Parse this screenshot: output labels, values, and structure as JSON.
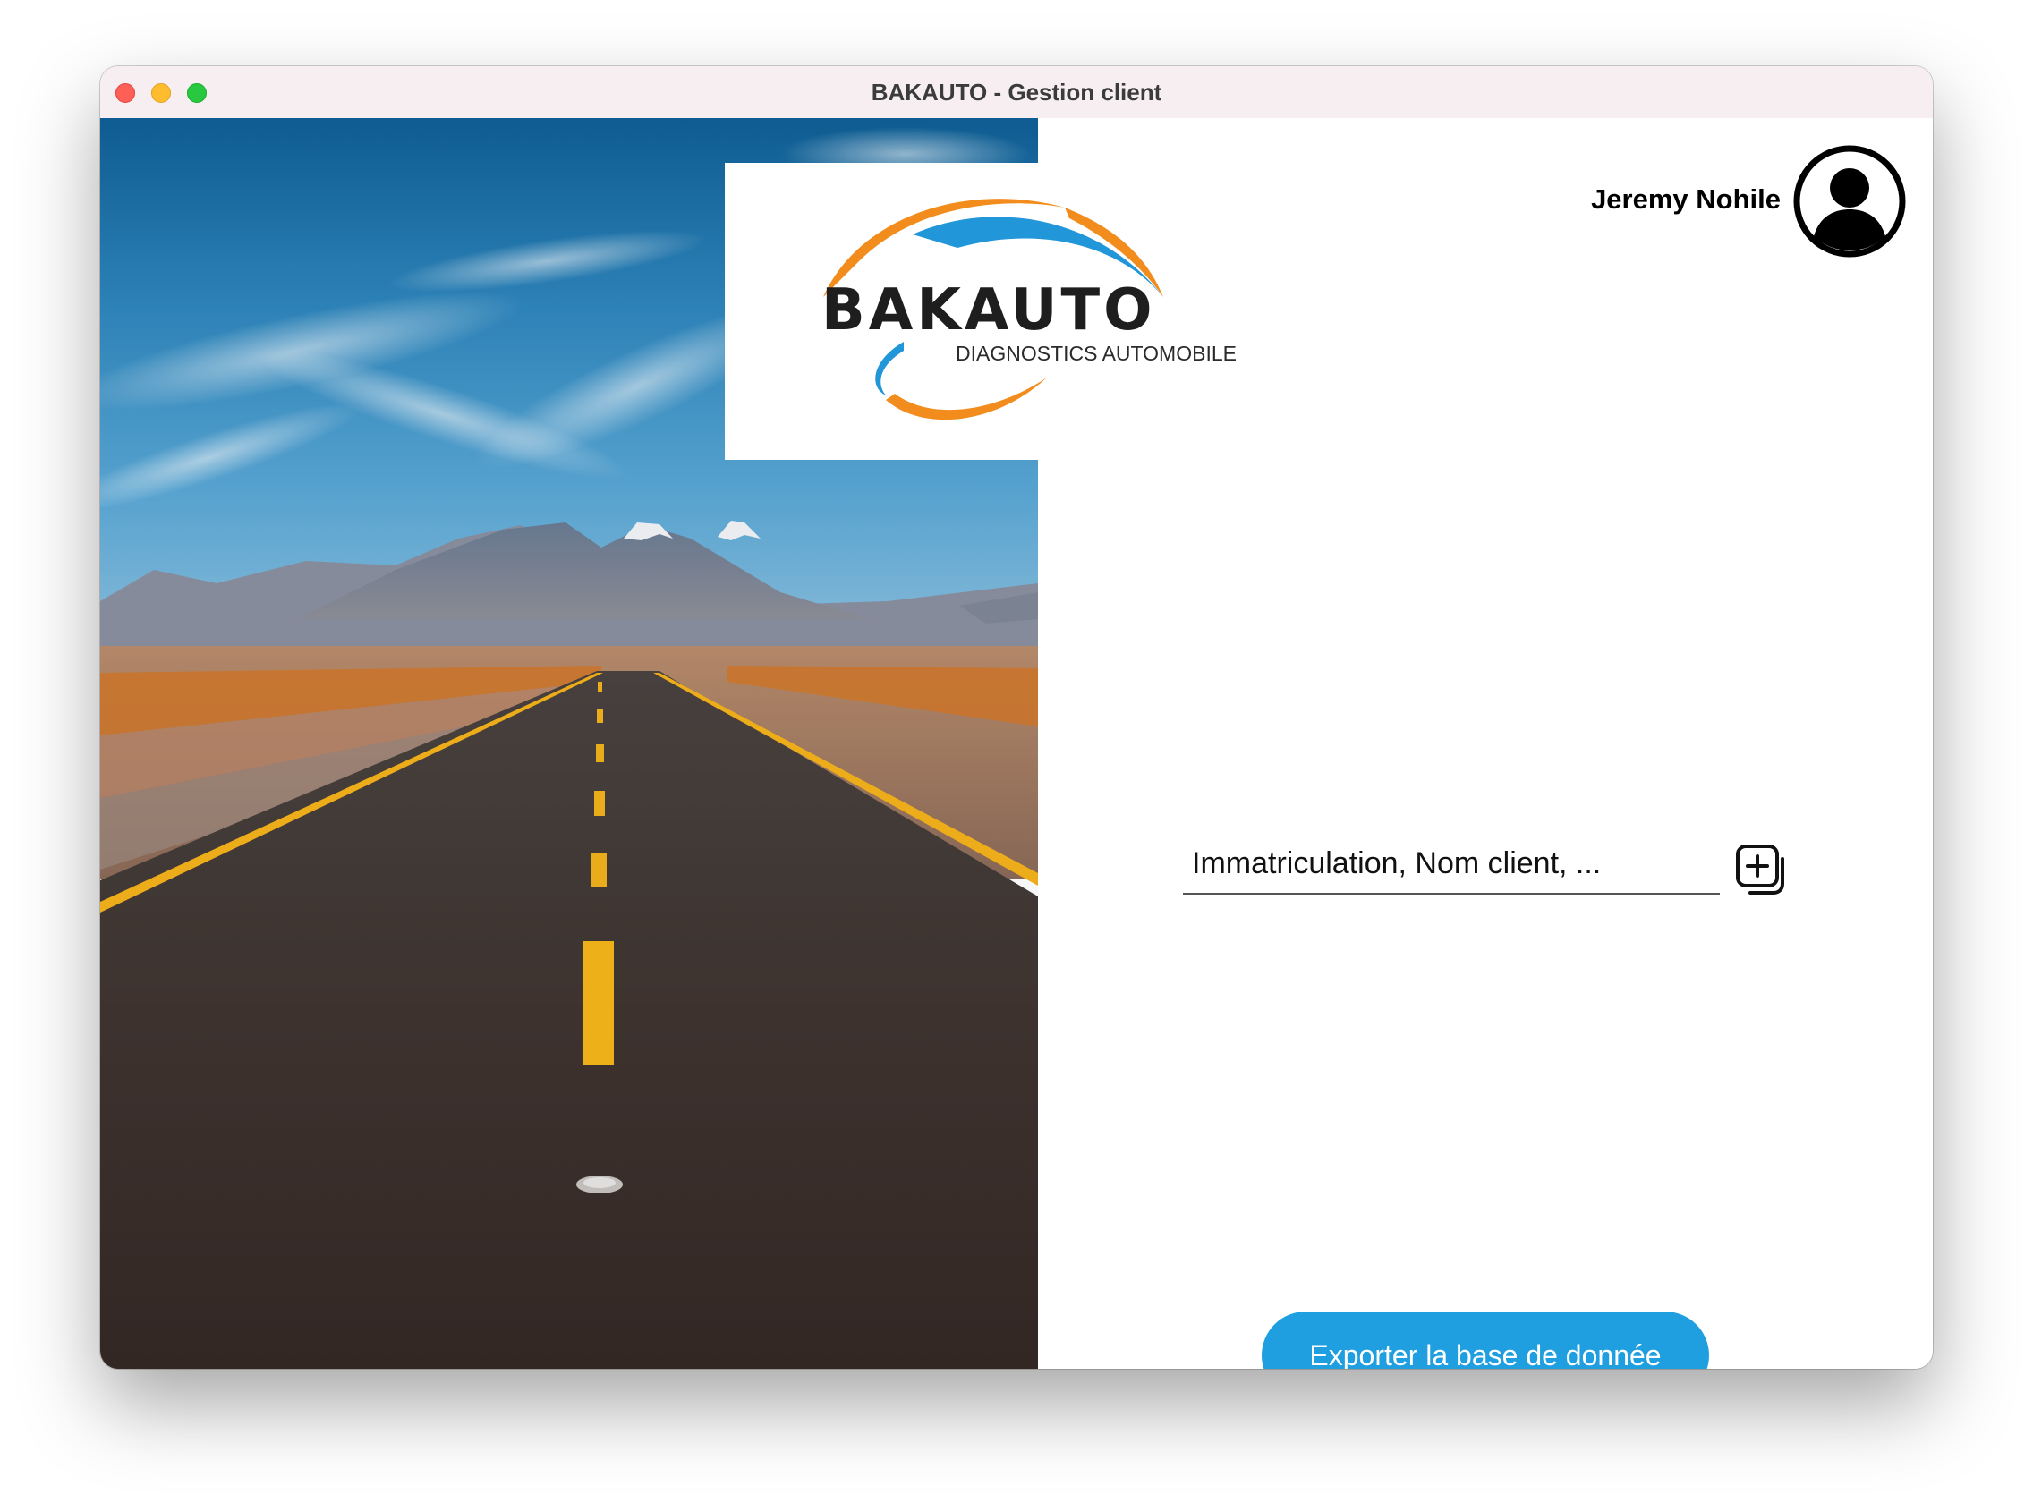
{
  "window": {
    "title": "BAKAUTO - Gestion client"
  },
  "brand": {
    "name": "BAKAUTO",
    "tagline": "DIAGNOSTICS AUTOMOBILE",
    "colors": {
      "orange": "#f28c1c",
      "blue": "#2196d8",
      "dark": "#1e1e1e"
    }
  },
  "user": {
    "name": "Jeremy Nohile",
    "avatar_icon": "user-circle-icon"
  },
  "search": {
    "placeholder": "Immatriculation, Nom client, ...",
    "value": "",
    "add_icon": "add-square-icon"
  },
  "actions": {
    "export_label": "Exporter la base de donnée",
    "export_color": "#1f9fe0"
  },
  "hero": {
    "description_icon": "road-landscape-image"
  }
}
